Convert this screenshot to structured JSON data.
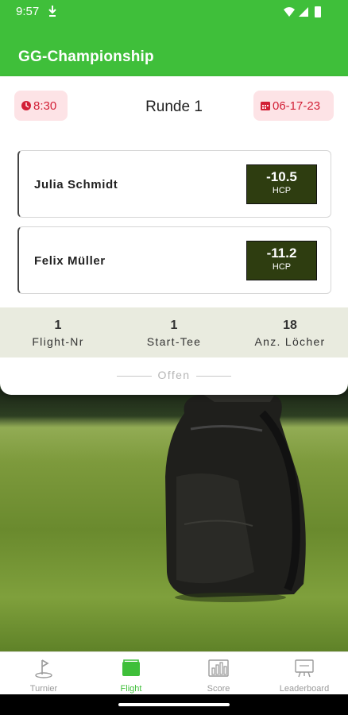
{
  "status_bar": {
    "time": "9:57"
  },
  "app": {
    "title": "GG-Championship"
  },
  "round": {
    "time": "8:30",
    "title": "Runde 1",
    "date": "06-17-23"
  },
  "players": [
    {
      "name": "Julia Schmidt",
      "hcp": "-10.5",
      "hcp_label": "HCP"
    },
    {
      "name": "Felix Müller",
      "hcp": "-11.2",
      "hcp_label": "HCP"
    }
  ],
  "stats": [
    {
      "value": "1",
      "label": "Flight-Nr"
    },
    {
      "value": "1",
      "label": "Start-Tee"
    },
    {
      "value": "18",
      "label": "Anz. Löcher"
    }
  ],
  "status_text": "Offen",
  "bottom_nav": {
    "items": [
      {
        "label": "Turnier",
        "icon": "golf-flag-icon"
      },
      {
        "label": "Flight",
        "icon": "flight-card-icon",
        "active": true
      },
      {
        "label": "Score",
        "icon": "bar-chart-icon"
      },
      {
        "label": "Leaderboard",
        "icon": "leaderboard-board-icon"
      }
    ]
  },
  "colors": {
    "brand_green": "#3fbf3a",
    "chip_background": "#fde3e6",
    "chip_text": "#d21f36",
    "hcp_background": "#2e3d10",
    "stats_background": "#e9ebdf"
  }
}
